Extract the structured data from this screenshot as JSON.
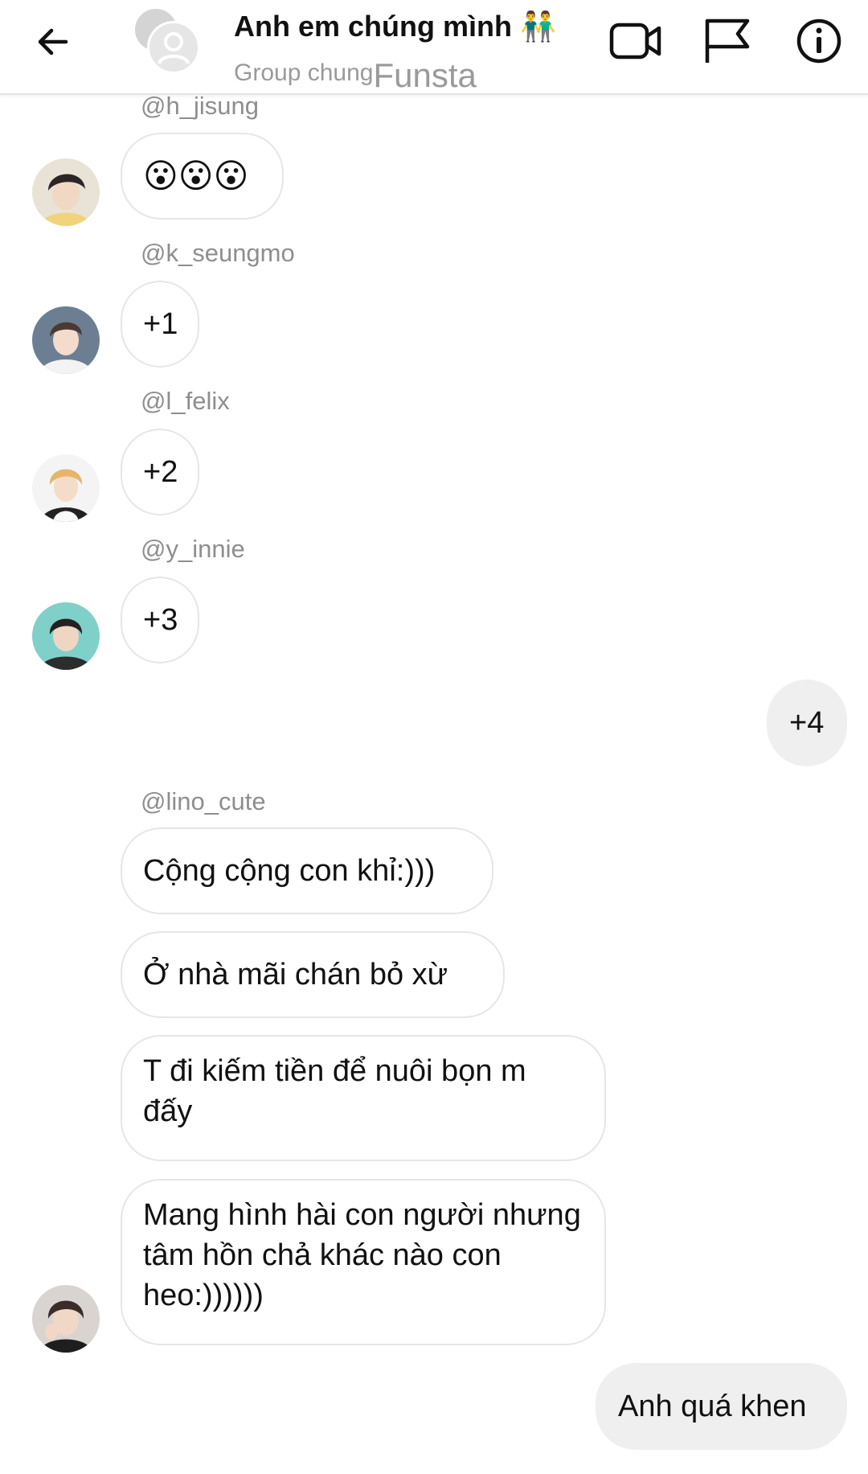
{
  "header": {
    "title": "Anh em chúng mình",
    "title_emoji": "👬",
    "subtitle": "Group chung",
    "subtitle_overlay": "Funsta",
    "icons": [
      "arrow-left-icon",
      "video-camera-icon",
      "flag-icon",
      "info-icon"
    ]
  },
  "messages": [
    {
      "sender": "@h_jisung",
      "text": "😮😮😮",
      "avatar": "avatar-h-jisung"
    },
    {
      "sender": "@k_seungmo",
      "text": "+1",
      "avatar": "avatar-k-seungmo"
    },
    {
      "sender": "@l_felix",
      "text": "+2",
      "avatar": "avatar-l-felix"
    },
    {
      "sender": "@y_innie",
      "text": "+3",
      "avatar": "avatar-y-innie"
    },
    {
      "mine": true,
      "text": "+4"
    },
    {
      "sender": "@lino_cute",
      "texts": [
        "Cộng cộng con khỉ:)))",
        "Ở nhà mãi chán bỏ xừ",
        "T đi kiếm tiền để nuôi bọn m đấy",
        "Mang hình hài con người nhưng tâm hồn chả khác nào con heo:))))))"
      ],
      "avatar": "avatar-lino-cute"
    },
    {
      "mine": true,
      "text": "Anh quá khen"
    }
  ],
  "colors": {
    "bubble_border": "#e6e6e6",
    "mine_bubble": "#efefef",
    "sender_text": "#8e8e8e"
  }
}
